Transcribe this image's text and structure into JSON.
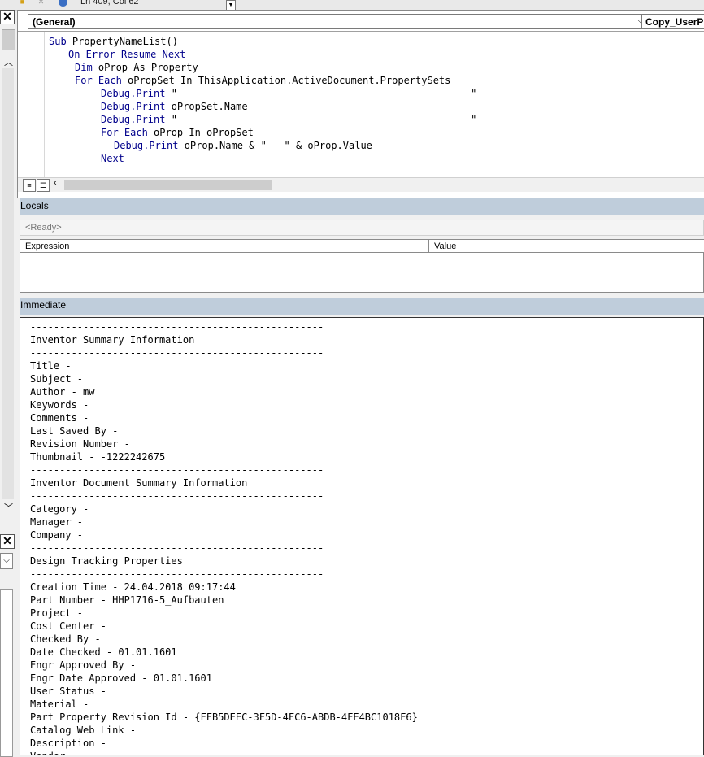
{
  "status_bar": {
    "position_text": "Ln 409, Col 62"
  },
  "code_window": {
    "object_combo": "(General)",
    "procedure_combo": "Copy_UserPr",
    "lines": [
      {
        "indent": 0,
        "kw": "Sub",
        "rest": " PropertyNameList()"
      },
      {
        "indent": 3,
        "kw": "On Error Resume Next",
        "rest": ""
      },
      {
        "indent": 4,
        "kw": "Dim",
        "rest": " oProp As Property"
      },
      {
        "indent": 4,
        "kw": "For Each",
        "rest": " oPropSet In ThisApplication.ActiveDocument.PropertySets"
      },
      {
        "indent": 8,
        "kw": "Debug.Print",
        "rest": " \"--------------------------------------------------\""
      },
      {
        "indent": 8,
        "kw": "Debug.Print",
        "rest": " oPropSet.Name"
      },
      {
        "indent": 8,
        "kw": "Debug.Print",
        "rest": " \"--------------------------------------------------\""
      },
      {
        "indent": 8,
        "kw": "For Each",
        "rest": " oProp In oPropSet"
      },
      {
        "indent": 10,
        "kw": "Debug.Print",
        "rest": " oProp.Name & \" - \" & oProp.Value"
      },
      {
        "indent": 8,
        "kw": "Next",
        "rest": ""
      }
    ]
  },
  "locals": {
    "title": "Locals",
    "status": "<Ready>",
    "columns": [
      "Expression",
      "Value"
    ]
  },
  "immediate": {
    "title": "Immediate",
    "lines": [
      "--------------------------------------------------",
      "Inventor Summary Information",
      "--------------------------------------------------",
      "Title -",
      "Subject -",
      "Author - mw",
      "Keywords -",
      "Comments -",
      "Last Saved By -",
      "Revision Number -",
      "Thumbnail - -1222242675",
      "--------------------------------------------------",
      "Inventor Document Summary Information",
      "--------------------------------------------------",
      "Category -",
      "Manager -",
      "Company -",
      "--------------------------------------------------",
      "Design Tracking Properties",
      "--------------------------------------------------",
      "Creation Time - 24.04.2018 09:17:44",
      "Part Number - HHP1716-5_Aufbauten",
      "Project -",
      "Cost Center -",
      "Checked By -",
      "Date Checked - 01.01.1601",
      "Engr Approved By -",
      "Engr Date Approved - 01.01.1601",
      "User Status -",
      "Material -",
      "Part Property Revision Id - {FFB5DEEC-3F5D-4FC6-ABDB-4FE4BC1018F6}",
      "Catalog Web Link -",
      "Description -",
      "Vendor"
    ]
  },
  "colors": {
    "keyword": "#00008b",
    "pane_title": "#bfcddb"
  }
}
